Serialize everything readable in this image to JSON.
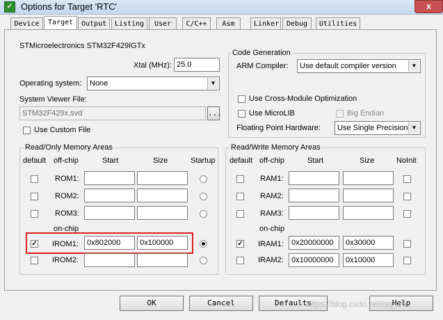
{
  "window": {
    "title": "Options for Target 'RTC'",
    "close_glyph": "x"
  },
  "tabs": [
    "Device",
    "Target",
    "Output",
    "Listing",
    "User",
    "C/C++",
    "Asm",
    "Linker",
    "Debug",
    "Utilities"
  ],
  "device": {
    "name": "STMicroelectronics STM32F429IGTx"
  },
  "xtal": {
    "label": "Xtal (MHz):",
    "value": "25.0"
  },
  "os": {
    "label": "Operating system:",
    "value": "None"
  },
  "svd": {
    "label": "System Viewer File:",
    "value": "STM32F429x.svd",
    "browse": "..."
  },
  "custom_file": {
    "label": "Use Custom File",
    "checked": false
  },
  "codegen": {
    "title": "Code Generation",
    "compiler_label": "ARM Compiler:",
    "compiler_value": "Use default compiler version",
    "cross_module": "Use Cross-Module Optimization",
    "microlib": "Use MicroLIB",
    "big_endian": "Big Endian",
    "fp_label": "Floating Point Hardware:",
    "fp_value": "Use Single Precision"
  },
  "rom": {
    "title": "Read/Only Memory Areas",
    "headers": {
      "default": "default",
      "offchip": "off-chip",
      "start": "Start",
      "size": "Size",
      "startup": "Startup"
    },
    "onchip": "on-chip",
    "rows": [
      {
        "label": "ROM1:",
        "start": "",
        "size": "",
        "default": false,
        "startup": false
      },
      {
        "label": "ROM2:",
        "start": "",
        "size": "",
        "default": false,
        "startup": false
      },
      {
        "label": "ROM3:",
        "start": "",
        "size": "",
        "default": false,
        "startup": false
      },
      {
        "label": "IROM1:",
        "start": "0x802000",
        "size": "0x100000",
        "default": true,
        "startup": true
      },
      {
        "label": "IROM2:",
        "start": "",
        "size": "",
        "default": false,
        "startup": false
      }
    ]
  },
  "ram": {
    "title": "Read/Write Memory Areas",
    "headers": {
      "default": "default",
      "offchip": "off-chip",
      "start": "Start",
      "size": "Size",
      "noinit": "NoInit"
    },
    "onchip": "on-chip",
    "rows": [
      {
        "label": "RAM1:",
        "start": "",
        "size": "",
        "default": false
      },
      {
        "label": "RAM2:",
        "start": "",
        "size": "",
        "default": false
      },
      {
        "label": "RAM3:",
        "start": "",
        "size": "",
        "default": false
      },
      {
        "label": "IRAM1:",
        "start": "0x20000000",
        "size": "0x30000",
        "default": true
      },
      {
        "label": "IRAM2:",
        "start": "0x10000000",
        "size": "0x10000",
        "default": false
      }
    ]
  },
  "buttons": {
    "ok": "OK",
    "cancel": "Cancel",
    "defaults": "Defaults",
    "help": "Help"
  },
  "watermark": "https://blog.csdn.net/qq_26",
  "colors": {
    "highlight": "#e0201f",
    "window_bg": "#f0f0f0"
  }
}
